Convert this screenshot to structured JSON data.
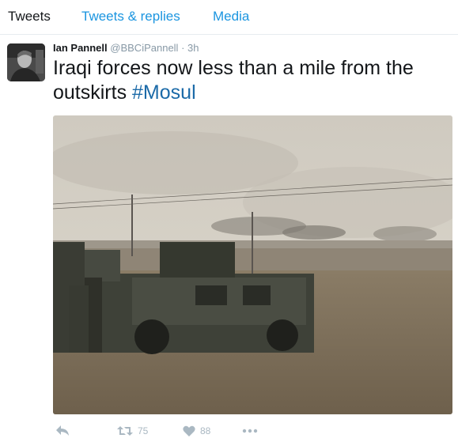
{
  "tabs": [
    {
      "label": "Tweets",
      "active": true
    },
    {
      "label": "Tweets & replies",
      "active": false
    },
    {
      "label": "Media",
      "active": false
    }
  ],
  "tweet": {
    "author_name": "Ian Pannell",
    "handle": "@BBCiPannell",
    "separator": "·",
    "time": "3h",
    "text": "Iraqi forces now less than a mile from the outskirts ",
    "hashtag": "#Mosul",
    "media_icon": "photo",
    "retweet_count": "75",
    "like_count": "88"
  },
  "icons": {
    "reply": "reply-icon",
    "retweet": "retweet-icon",
    "like": "heart-icon",
    "more": "more-icon"
  },
  "colors": {
    "link": "#1b95e0",
    "hashtag": "#1b6aa8",
    "muted": "#8899a6",
    "action_gray": "#aab8c2"
  }
}
